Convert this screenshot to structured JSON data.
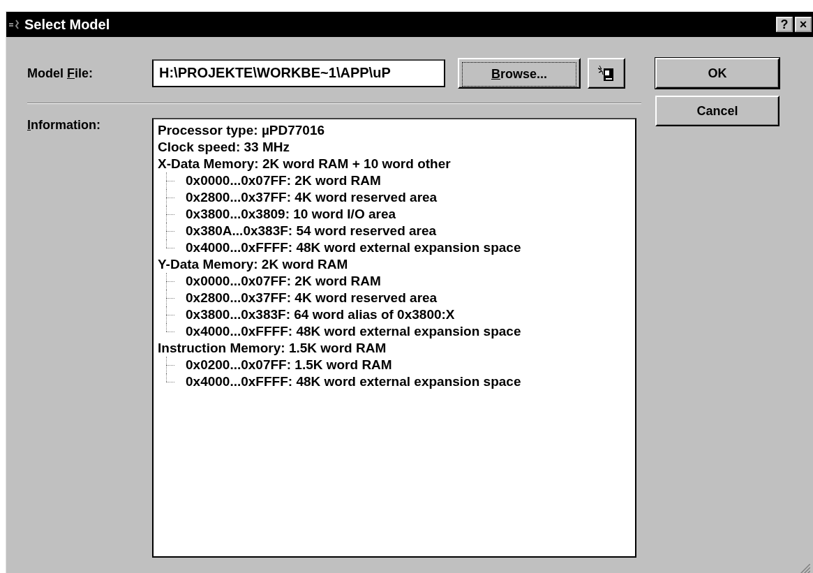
{
  "window": {
    "title": "Select Model",
    "title_buttons": [
      "?",
      "×"
    ]
  },
  "model_file": {
    "label": {
      "before": "Model ",
      "key": "F",
      "after": "ile:"
    },
    "value": "H:\\PROJEKTE\\WORKBE~1\\APP\\uP"
  },
  "browse_button": {
    "key": "B",
    "after": "rowse..."
  },
  "buttons": [
    "OK",
    "Cancel"
  ],
  "information": {
    "label": {
      "key": "I",
      "after": "nformation:"
    },
    "items": [
      {
        "text": "Processor type: µPD77016"
      },
      {
        "text": "Clock speed: 33 MHz"
      },
      {
        "text": "X-Data Memory: 2K word RAM + 10 word other",
        "children": [
          {
            "text": "0x0000...0x07FF: 2K word RAM"
          },
          {
            "text": "0x2800...0x37FF: 4K word reserved area"
          },
          {
            "text": "0x3800...0x3809: 10 word I/O area"
          },
          {
            "text": "0x380A...0x383F: 54 word reserved area"
          },
          {
            "text": "0x4000...0xFFFF: 48K word external expansion space"
          }
        ]
      },
      {
        "text": "Y-Data Memory: 2K word RAM",
        "children": [
          {
            "text": "0x0000...0x07FF: 2K word RAM"
          },
          {
            "text": "0x2800...0x37FF: 4K word reserved area"
          },
          {
            "text": "0x3800...0x383F: 64 word alias of 0x3800:X"
          },
          {
            "text": "0x4000...0xFFFF: 48K word external expansion space"
          }
        ]
      },
      {
        "text": "Instruction Memory: 1.5K word RAM",
        "children": [
          {
            "text": "0x0200...0x07FF: 1.5K word RAM"
          },
          {
            "text": "0x4000...0xFFFF: 48K word external expansion space"
          }
        ]
      }
    ]
  }
}
